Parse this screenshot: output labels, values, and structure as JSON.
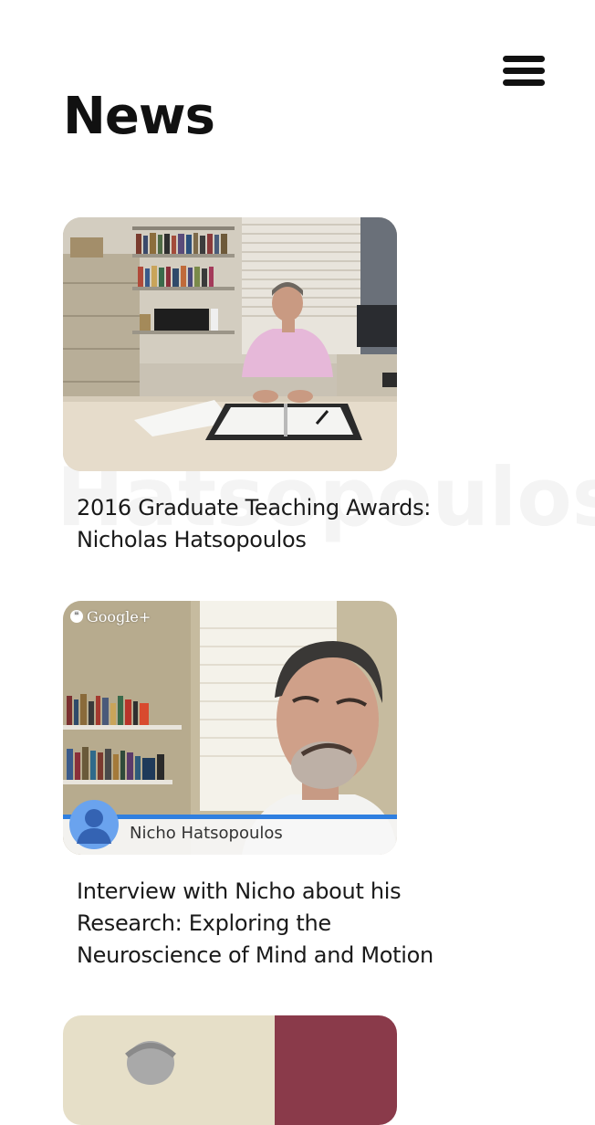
{
  "header": {
    "title": "News",
    "menu_icon": "hamburger-menu-icon"
  },
  "background_text": "Hatsopoulos",
  "articles": [
    {
      "title": "2016 Graduate Teaching Awards: Nicholas Hatsopoulos",
      "thumbnail": "office-desk-video-still"
    },
    {
      "title": "Interview with Nicho about his Research: Exploring the Neuroscience of Mind and Motion",
      "thumbnail": "video-call-still",
      "overlay": {
        "brand": "Google+",
        "caller_name": "Nicho Hatsopoulos"
      }
    },
    {
      "title": "",
      "thumbnail": "partial-photo"
    }
  ],
  "colors": {
    "text": "#111111",
    "background": "#ffffff",
    "watermark": "#f4f4f4",
    "call_bar": "#2f7fe0",
    "avatar": "#4a86e8"
  }
}
